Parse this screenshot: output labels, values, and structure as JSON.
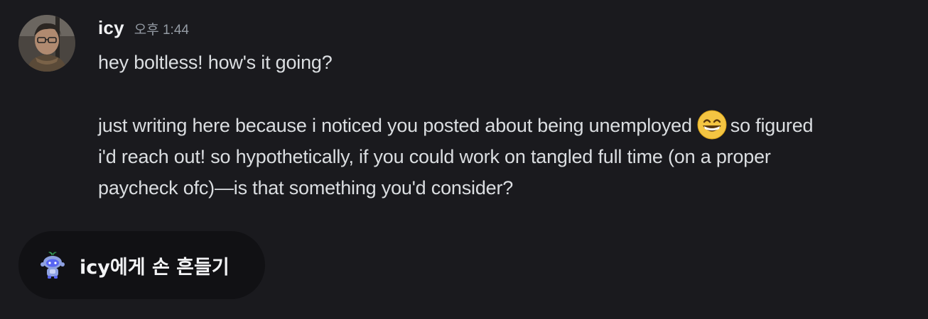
{
  "message": {
    "author": "icy",
    "timestamp": "오후 1:44",
    "lines": {
      "greeting": "hey boltless! how's it going?",
      "body_line1_a": "just writing here because i noticed you posted about being unemployed",
      "body_line1_b": "so figured",
      "body_line2": "i'd reach out! so hypothetically, if you could work on tangled full time (on a proper",
      "body_line3": "paycheck ofc)—is that something you'd consider?"
    },
    "emoji": "grinning-face-with-smiling-eyes"
  },
  "wave_button": {
    "label": "icy에게 손 흔들기",
    "icon": "wumpus-wave-icon"
  },
  "colors": {
    "background": "#1a1a1e",
    "button_background": "#111114",
    "text": "#dbdee1",
    "username": "#f2f3f5",
    "timestamp": "#949ba4"
  }
}
